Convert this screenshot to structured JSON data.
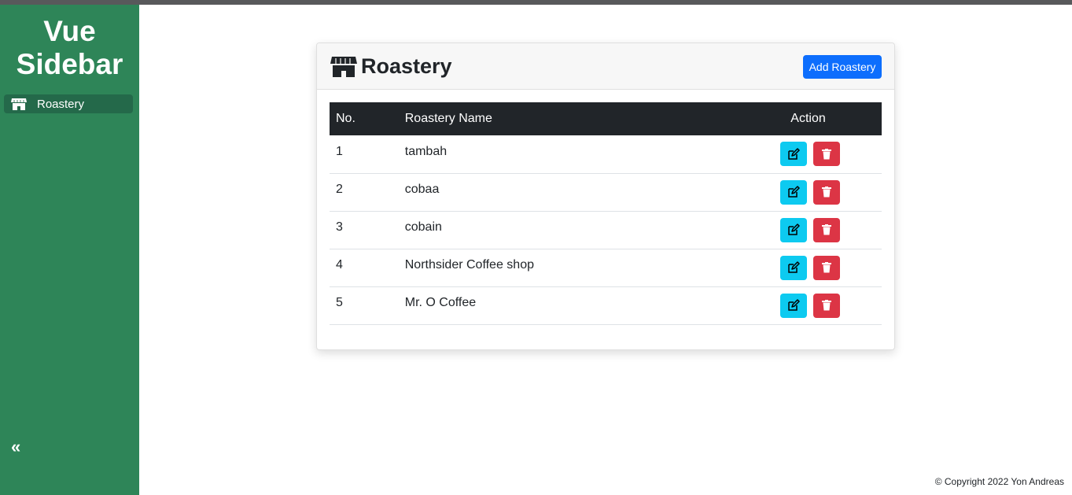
{
  "sidebar": {
    "brand_line1": "Vue",
    "brand_line2": "Sidebar",
    "items": [
      {
        "label": "Roastery",
        "icon": "store-icon"
      }
    ],
    "collapse_icon": "double-chevron-left-icon",
    "collapse_glyph": "«"
  },
  "card": {
    "title": "Roastery",
    "title_icon": "store-icon",
    "add_button_label": "Add Roastery"
  },
  "table": {
    "headers": {
      "no": "No.",
      "name": "Roastery Name",
      "action": "Action"
    },
    "rows": [
      {
        "no": "1",
        "name": "tambah"
      },
      {
        "no": "2",
        "name": "cobaa"
      },
      {
        "no": "3",
        "name": "cobain"
      },
      {
        "no": "4",
        "name": "Northsider Coffee shop"
      },
      {
        "no": "5",
        "name": "Mr. O Coffee"
      }
    ]
  },
  "footer": {
    "text": "© Copyright 2022 Yon Andreas"
  },
  "colors": {
    "sidebar_bg": "#2e8558",
    "active_item_bg": "#24694a",
    "primary": "#0d6efd",
    "info": "#0dcaf0",
    "danger": "#dc3545",
    "table_header": "#212529"
  }
}
